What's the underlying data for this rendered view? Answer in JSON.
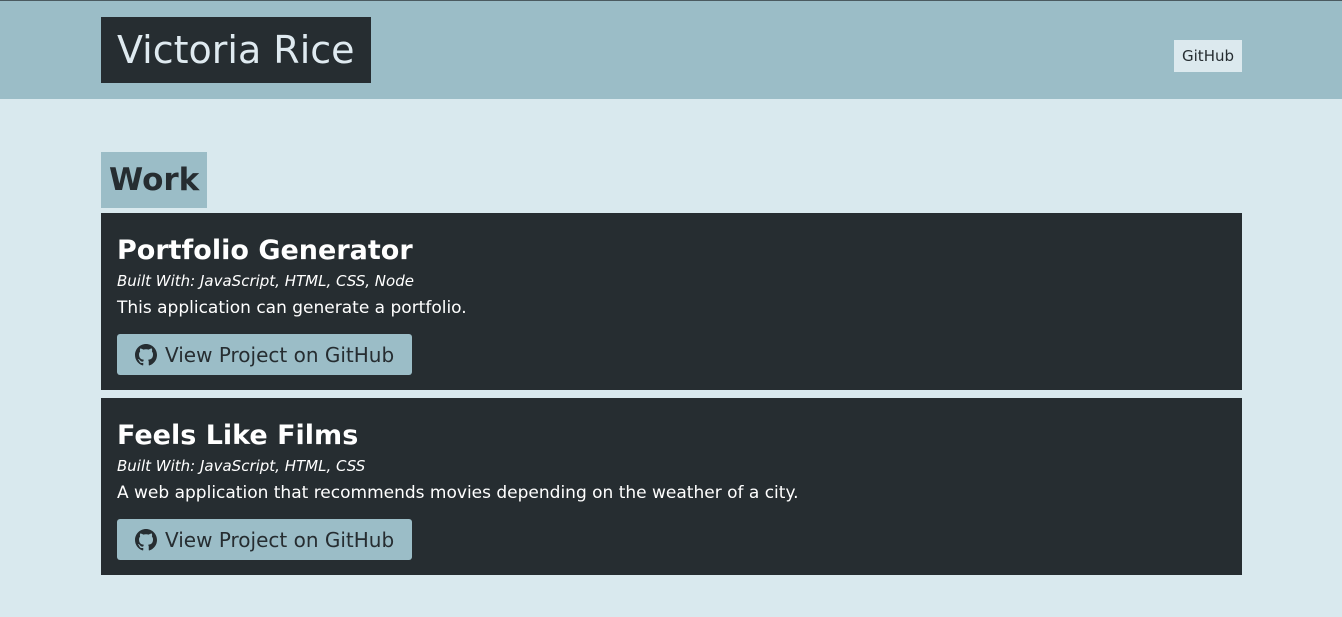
{
  "header": {
    "brand": "Victoria Rice",
    "nav_link": "GitHub"
  },
  "work": {
    "heading": "Work",
    "projects": [
      {
        "title": "Portfolio Generator",
        "built_with": "Built With: JavaScript, HTML, CSS, Node",
        "description": "This application can generate a portfolio.",
        "button_label": "View Project on GitHub",
        "button_icon": "github-icon"
      },
      {
        "title": "Feels Like Films",
        "built_with": "Built With: JavaScript, HTML, CSS",
        "description": "A web application that recommends movies depending on the weather of a city.",
        "button_label": "View Project on GitHub",
        "button_icon": "github-icon"
      }
    ]
  },
  "colors": {
    "page_background": "#d9e9ee",
    "header_background": "#9bbdc7",
    "dark_panel": "#262d31",
    "accent": "#9bbdc7"
  }
}
